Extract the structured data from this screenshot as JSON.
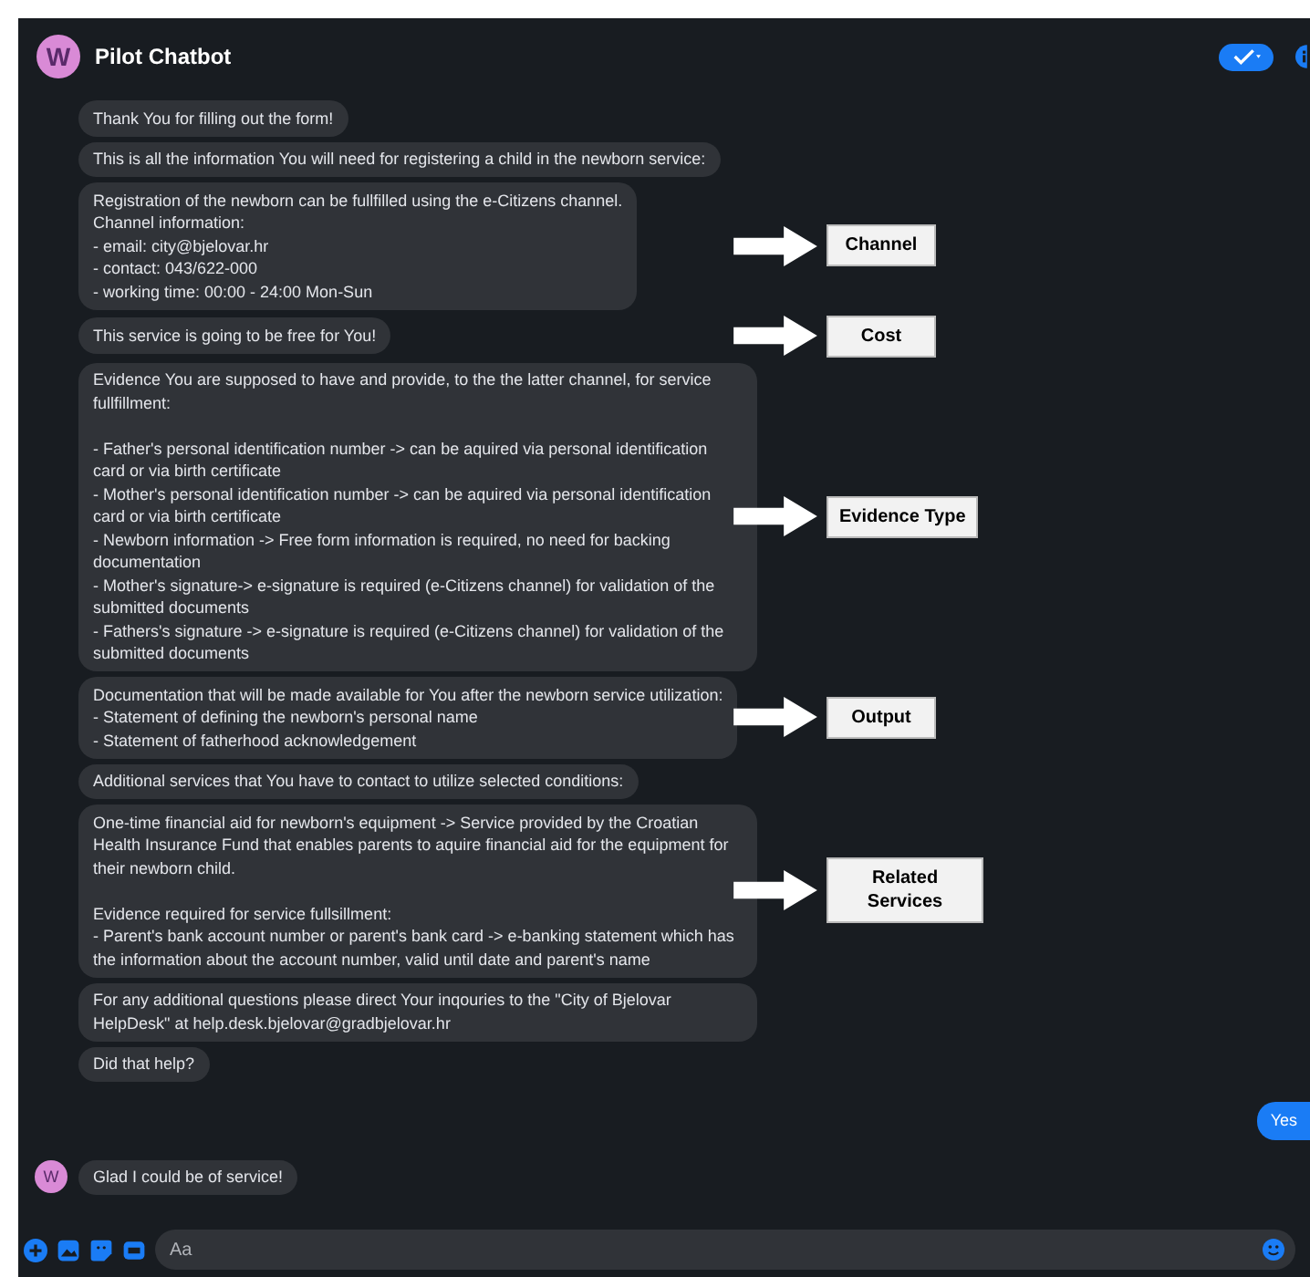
{
  "header": {
    "avatar_letter": "W",
    "title": "Pilot Chatbot"
  },
  "messages": [
    {
      "kind": "bot",
      "text": "Thank You for filling out the form!"
    },
    {
      "kind": "bot",
      "text": "This is all the information You will need for registering a child in the newborn service:"
    },
    {
      "kind": "bot",
      "text": "Registration of the newborn can be fullfilled using the e-Citizens channel.\nChannel information:\n - email: city@bjelovar.hr\n - contact: 043/622-000\n - working time: 00:00 - 24:00 Mon-Sun",
      "annotation": "Channel"
    },
    {
      "kind": "bot",
      "text": "This service is going to be free for You!",
      "annotation": "Cost"
    },
    {
      "kind": "bot",
      "text": "Evidence You are supposed to have and provide, to the the latter channel, for service fullfillment:\n\n - Father's personal identification number -> can be aquired via personal identification card or via birth certificate\n - Mother's personal identification number -> can be aquired via personal identification card or via birth certificate\n - Newborn information -> Free form information is required, no need for backing documentation\n - Mother's signature-> e-signature is required (e-Citizens channel) for validation of the submitted documents\n - Fathers's signature -> e-signature is required (e-Citizens channel) for validation of the submitted documents",
      "annotation": "Evidence Type"
    },
    {
      "kind": "bot",
      "text": "Documentation that will be made available for You after the newborn service utilization:\n- Statement of defining the newborn's personal name\n- Statement of fatherhood acknowledgement",
      "annotation": "Output"
    },
    {
      "kind": "bot",
      "text": "Additional services that You have to contact to utilize selected conditions:"
    },
    {
      "kind": "bot",
      "text": "One-time financial aid for newborn's equipment -> Service provided by the Croatian Health Insurance Fund that enables parents to aquire financial aid for the equipment for their newborn child.\n\nEvidence required for service fullsillment:\n - Parent's bank account number or parent's bank card -> e-banking statement which has the information about the account number, valid until date and parent's name",
      "annotation": "Related Services"
    },
    {
      "kind": "bot",
      "text": "For any additional questions please direct Your inqouries to the \"City of Bjelovar HelpDesk\" at help.desk.bjelovar@gradbjelovar.hr"
    },
    {
      "kind": "bot",
      "text": "Did that help?"
    },
    {
      "kind": "user",
      "text": "Yes"
    },
    {
      "kind": "bot",
      "text": "Glad I could be of service!",
      "avatar_letter": "W"
    }
  ],
  "composer": {
    "placeholder": "Aa"
  }
}
